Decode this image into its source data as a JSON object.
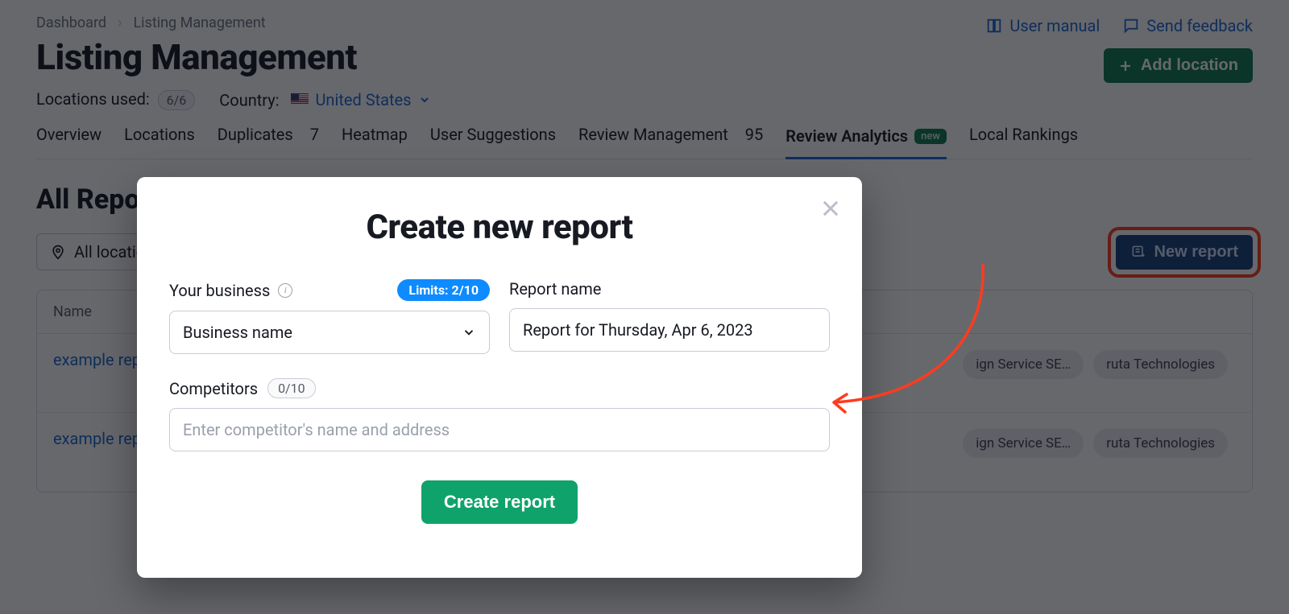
{
  "breadcrumb": {
    "root": "Dashboard",
    "current": "Listing Management"
  },
  "header": {
    "title": "Listing Management",
    "user_manual": "User manual",
    "send_feedback": "Send feedback",
    "add_location": "Add location"
  },
  "meta": {
    "locations_used_label": "Locations used:",
    "locations_used_value": "6/6",
    "country_label": "Country:",
    "country_value": "United States"
  },
  "tabs": {
    "overview": "Overview",
    "locations": "Locations",
    "duplicates_label": "Duplicates",
    "duplicates_count": "7",
    "heatmap": "Heatmap",
    "user_suggestions": "User Suggestions",
    "review_mgmt_label": "Review Management",
    "review_mgmt_count": "95",
    "review_analytics": "Review Analytics",
    "review_analytics_badge": "new",
    "local_rankings": "Local Rankings"
  },
  "section": {
    "title": "All Reports",
    "filter_label": "All locations",
    "new_report": "New report"
  },
  "table": {
    "header_name": "Name",
    "rows": [
      {
        "name": "example report",
        "tags": [
          "ign Service SE…",
          "ruta Technologies"
        ]
      },
      {
        "name": "example report",
        "tags": [
          "ign Service SE…",
          "ruta Technologies"
        ]
      }
    ]
  },
  "modal": {
    "title": "Create new report",
    "your_business_label": "Your business",
    "limits_badge": "Limits: 2/10",
    "business_select_value": "Business name",
    "report_name_label": "Report name",
    "report_name_value": "Report for Thursday, Apr 6, 2023",
    "competitors_label": "Competitors",
    "competitors_count": "0/10",
    "competitors_placeholder": "Enter competitor's name and address",
    "create_button": "Create report"
  }
}
